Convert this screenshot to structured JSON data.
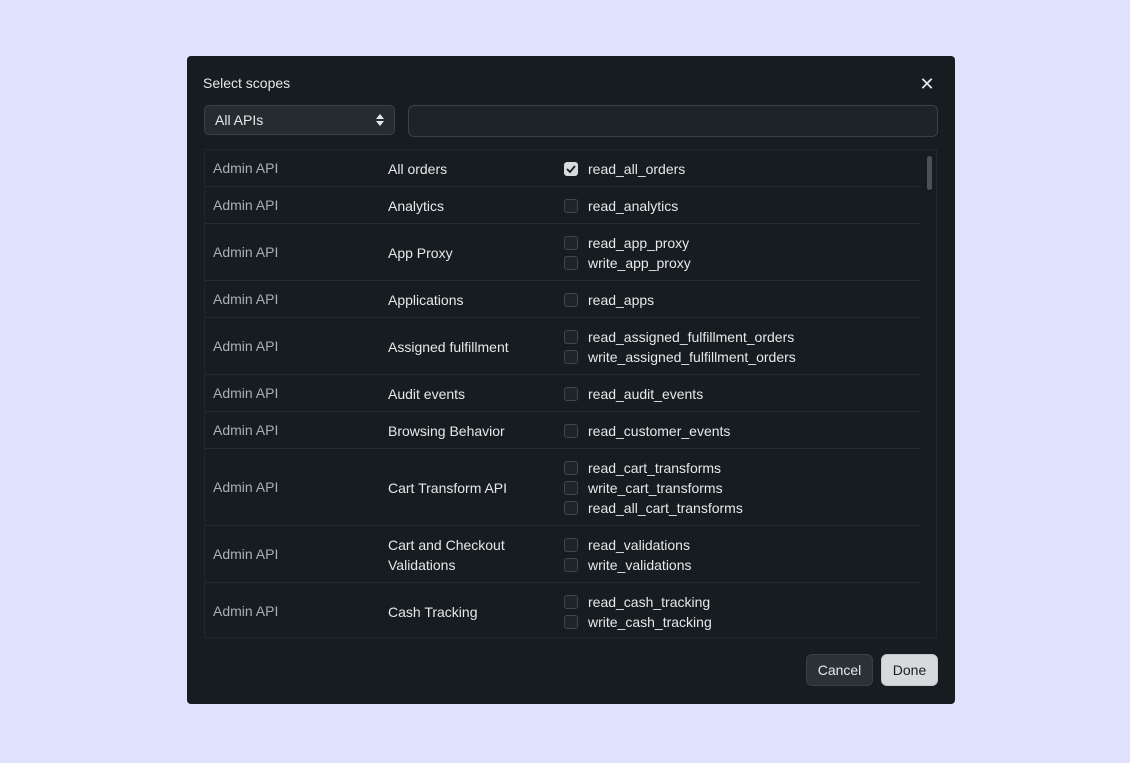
{
  "dialog": {
    "title": "Select scopes",
    "close_icon": "close-icon",
    "api_select": {
      "value": "All APIs"
    },
    "search": {
      "value": "",
      "placeholder": ""
    },
    "cancel_label": "Cancel",
    "done_label": "Done"
  },
  "rows": [
    {
      "api": "Admin API",
      "name": "All orders",
      "scopes": [
        {
          "label": "read_all_orders",
          "checked": true
        }
      ]
    },
    {
      "api": "Admin API",
      "name": "Analytics",
      "scopes": [
        {
          "label": "read_analytics",
          "checked": false
        }
      ]
    },
    {
      "api": "Admin API",
      "name": "App Proxy",
      "scopes": [
        {
          "label": "read_app_proxy",
          "checked": false
        },
        {
          "label": "write_app_proxy",
          "checked": false
        }
      ]
    },
    {
      "api": "Admin API",
      "name": "Applications",
      "scopes": [
        {
          "label": "read_apps",
          "checked": false
        }
      ]
    },
    {
      "api": "Admin API",
      "name": "Assigned fulfillment",
      "scopes": [
        {
          "label": "read_assigned_fulfillment_orders",
          "checked": false
        },
        {
          "label": "write_assigned_fulfillment_orders",
          "checked": false
        }
      ]
    },
    {
      "api": "Admin API",
      "name": "Audit events",
      "scopes": [
        {
          "label": "read_audit_events",
          "checked": false
        }
      ]
    },
    {
      "api": "Admin API",
      "name": "Browsing Behavior",
      "scopes": [
        {
          "label": "read_customer_events",
          "checked": false
        }
      ]
    },
    {
      "api": "Admin API",
      "name": "Cart Transform API",
      "scopes": [
        {
          "label": "read_cart_transforms",
          "checked": false
        },
        {
          "label": "write_cart_transforms",
          "checked": false
        },
        {
          "label": "read_all_cart_transforms",
          "checked": false
        }
      ]
    },
    {
      "api": "Admin API",
      "name": "Cart and Checkout Validations",
      "scopes": [
        {
          "label": "read_validations",
          "checked": false
        },
        {
          "label": "write_validations",
          "checked": false
        }
      ]
    },
    {
      "api": "Admin API",
      "name": "Cash Tracking",
      "scopes": [
        {
          "label": "read_cash_tracking",
          "checked": false
        },
        {
          "label": "write_cash_tracking",
          "checked": false
        }
      ]
    }
  ]
}
